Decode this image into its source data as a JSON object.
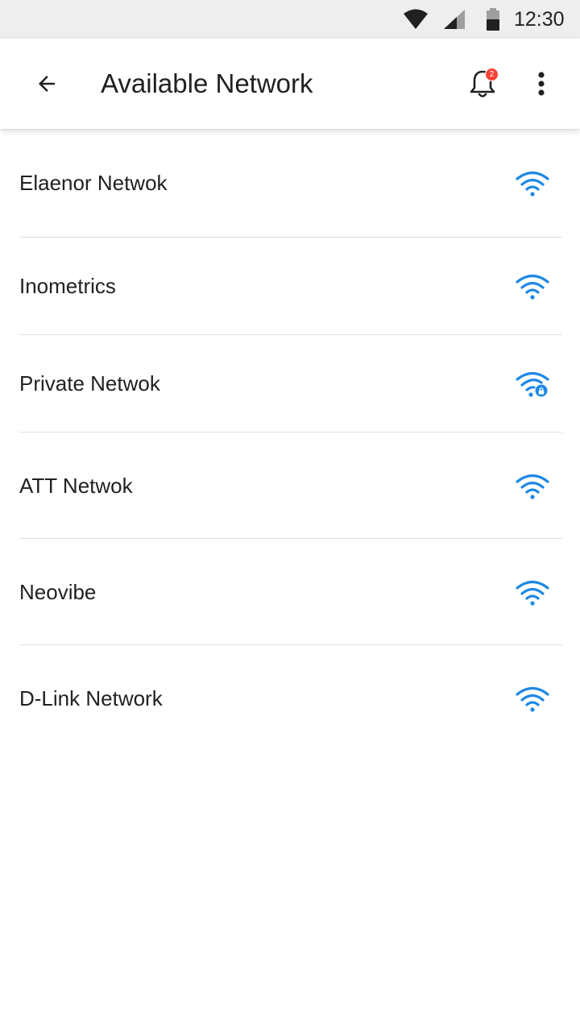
{
  "status_bar": {
    "time": "12:30",
    "icons": [
      "wifi-icon",
      "signal-icon",
      "battery-icon"
    ]
  },
  "app_bar": {
    "title": "Available Network",
    "notification_count": "2",
    "icons": [
      "back-arrow-icon",
      "bell-icon",
      "more-vert-icon"
    ]
  },
  "networks": [
    {
      "name": "Elaenor Netwok",
      "locked": false
    },
    {
      "name": "Inometrics",
      "locked": false
    },
    {
      "name": "Private Netwok",
      "locked": true
    },
    {
      "name": "ATT Netwok",
      "locked": false
    },
    {
      "name": "Neovibe",
      "locked": false
    },
    {
      "name": "D-Link Network",
      "locked": false
    }
  ],
  "colors": {
    "accent": "#1e88e5",
    "badge": "#f44336",
    "status_bar_bg": "#eeeeee",
    "text": "#212121",
    "divider": "#e0e0e0"
  }
}
